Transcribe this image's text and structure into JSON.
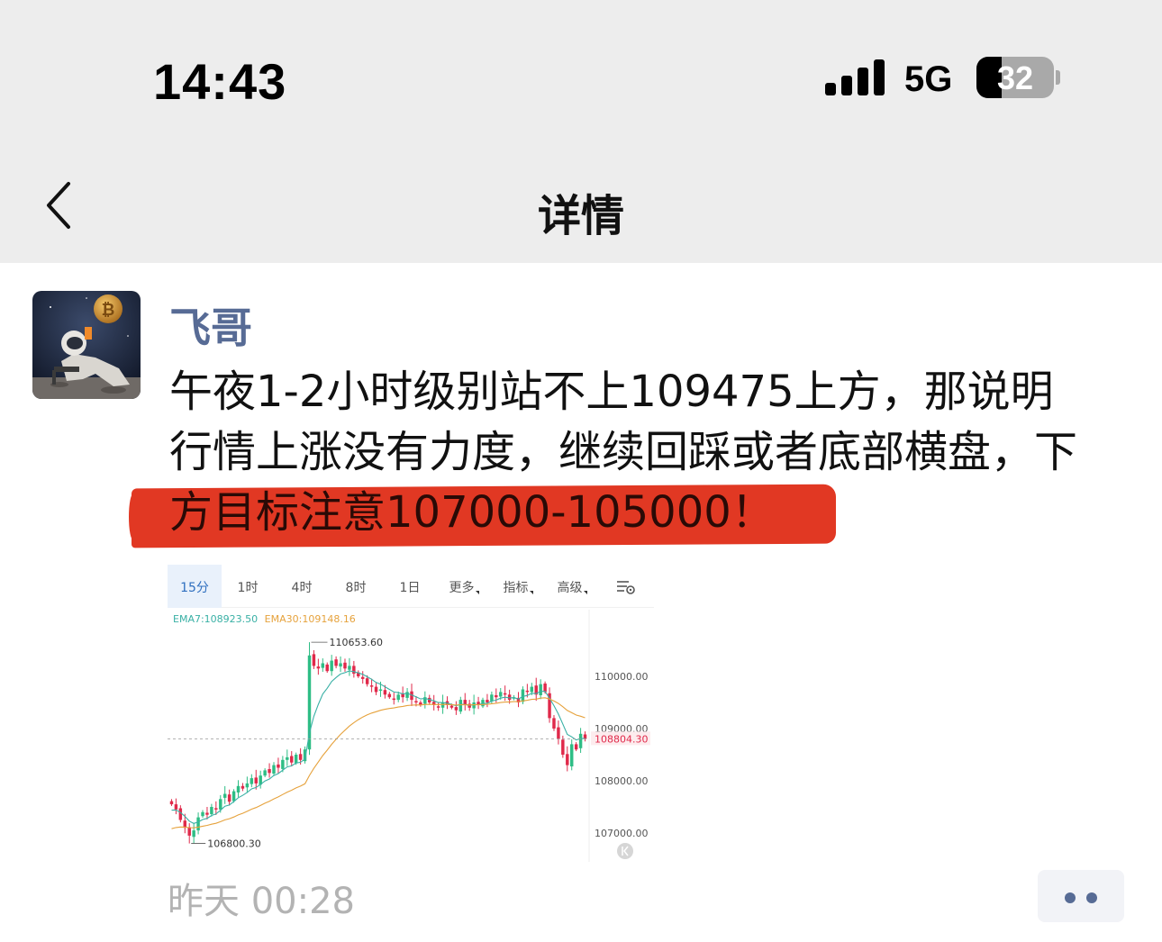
{
  "status_bar": {
    "time": "14:43",
    "network": "5G",
    "battery": "32",
    "battery_level": 0.32
  },
  "nav": {
    "title": "详情",
    "back_icon": "chevron-left-icon"
  },
  "post": {
    "author": "飞哥",
    "lines": [
      "午夜1-2小时级别站不上109475上方，那说明",
      "行情上涨没有力度，继续回踩或者底部横盘，下",
      "方目标注意107000-105000！"
    ],
    "highlight_color": "#e13823",
    "timestamp": "昨天 00:28"
  },
  "chart_toolbar": {
    "timeframes": [
      "15分",
      "1时",
      "4时",
      "8时",
      "1日"
    ],
    "dropdowns": [
      "更多",
      "指标",
      "高级"
    ],
    "active": "15分"
  },
  "indicators": {
    "ema7": "EMA7:108923.50",
    "ema30": "EMA30:109148.16"
  },
  "chart_data": {
    "type": "candlestick",
    "y_ticks": [
      "110000.00",
      "109000.00",
      "108000.00",
      "107000.00"
    ],
    "y_tick_values": [
      110000,
      109000,
      108000,
      107000
    ],
    "current_price_label": "108804.30",
    "current_price": 108804.3,
    "high_label": "110653.60",
    "high": 110653.6,
    "low_label": "106800.30",
    "low": 106800.3,
    "colors": {
      "up": "#2ebd85",
      "down": "#e0294a",
      "ema7": "#39b0a5",
      "ema30": "#e6a23c"
    },
    "close": [
      107550,
      107450,
      107250,
      107100,
      106950,
      107050,
      107300,
      107400,
      107350,
      107500,
      107450,
      107650,
      107750,
      107600,
      107800,
      107900,
      107850,
      107950,
      108050,
      107950,
      108100,
      108200,
      108150,
      108300,
      108250,
      108400,
      108450,
      108350,
      108500,
      108400,
      108600,
      110400,
      110200,
      110150,
      110250,
      110100,
      110300,
      110200,
      110250,
      110150,
      110200,
      110050,
      110000,
      109950,
      109850,
      109800,
      109700,
      109750,
      109650,
      109600,
      109550,
      109650,
      109600,
      109700,
      109550,
      109500,
      109450,
      109600,
      109500,
      109450,
      109400,
      109500,
      109450,
      109400,
      109350,
      109550,
      109450,
      109400,
      109500,
      109450,
      109550,
      109500,
      109650,
      109600,
      109700,
      109650,
      109550,
      109600,
      109500,
      109750,
      109700,
      109800,
      109650,
      109850,
      109700,
      109200,
      109000,
      108800,
      108500,
      108300,
      108700,
      108600,
      108900,
      108800
    ]
  },
  "more_button_icon": "more-dots-icon"
}
